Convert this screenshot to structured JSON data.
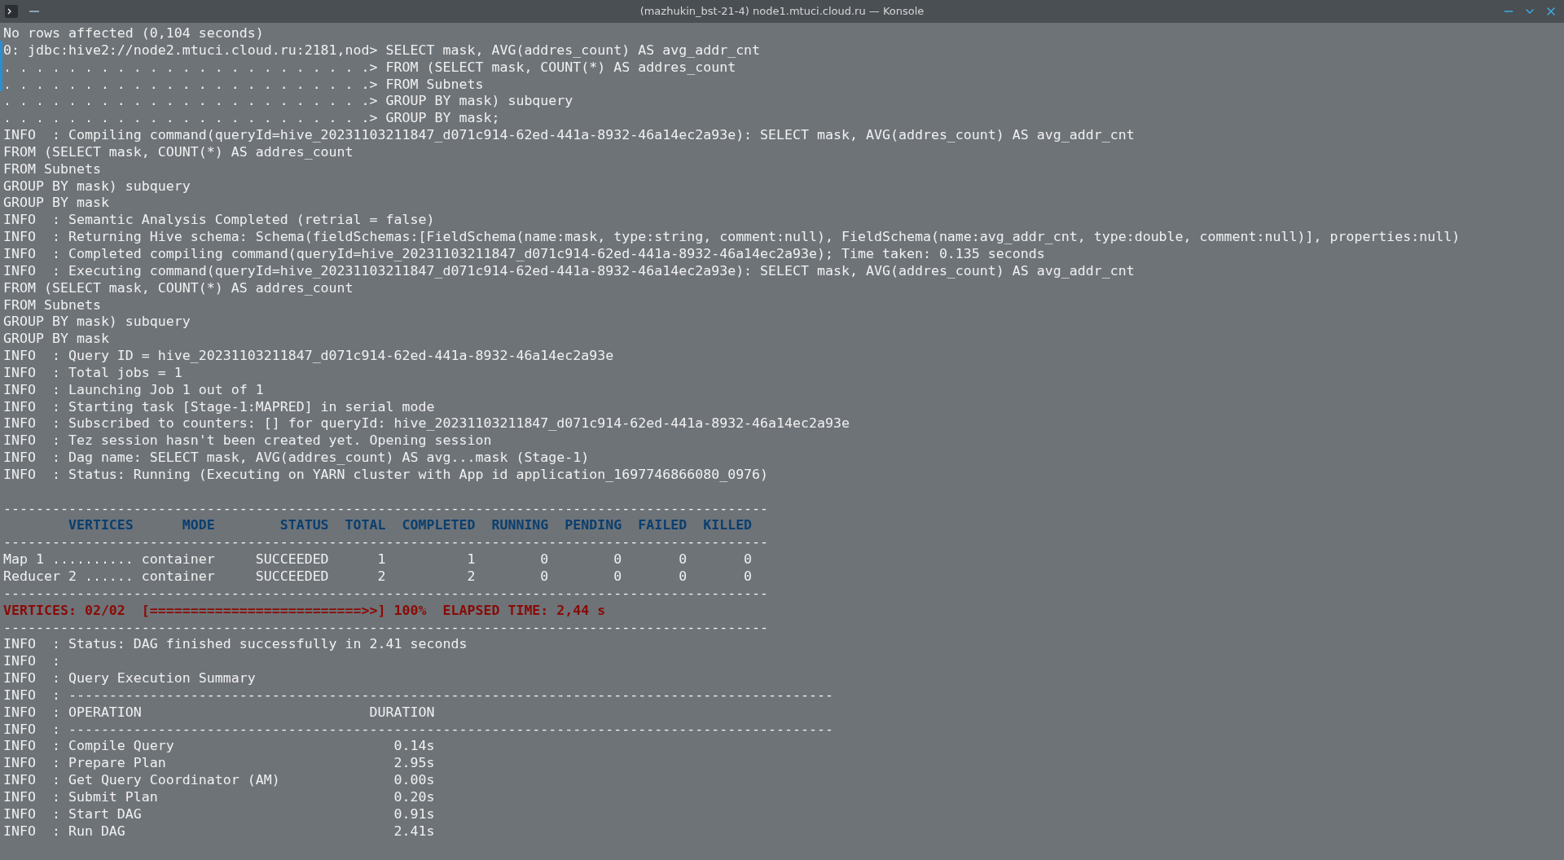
{
  "window": {
    "title": "(mazhukin_bst-21-4) node1.mtuci.cloud.ru — Konsole"
  },
  "terminal": {
    "lines": [
      {
        "kind": "output",
        "text": "No rows affected (0,104 seconds)"
      },
      {
        "kind": "output",
        "marked": true,
        "text": "0: jdbc:hive2://node2.mtuci.cloud.ru:2181,nod> SELECT mask, AVG(addres_count) AS avg_addr_cnt"
      },
      {
        "kind": "output",
        "marked": true,
        "text": ". . . . . . . . . . . . . . . . . . . . . . .> FROM (SELECT mask, COUNT(*) AS addres_count"
      },
      {
        "kind": "output",
        "marked": true,
        "text": ". . . . . . . . . . . . . . . . . . . . . . .> FROM Subnets"
      },
      {
        "kind": "output",
        "marked": false,
        "text": ". . . . . . . . . . . . . . . . . . . . . . .> GROUP BY mask) subquery"
      },
      {
        "kind": "output",
        "text": ". . . . . . . . . . . . . . . . . . . . . . .> GROUP BY mask;"
      },
      {
        "kind": "output",
        "text": "INFO  : Compiling command(queryId=hive_20231103211847_d071c914-62ed-441a-8932-46a14ec2a93e): SELECT mask, AVG(addres_count) AS avg_addr_cnt"
      },
      {
        "kind": "output",
        "text": "FROM (SELECT mask, COUNT(*) AS addres_count"
      },
      {
        "kind": "output",
        "text": "FROM Subnets"
      },
      {
        "kind": "output",
        "text": "GROUP BY mask) subquery"
      },
      {
        "kind": "output",
        "text": "GROUP BY mask"
      },
      {
        "kind": "output",
        "text": "INFO  : Semantic Analysis Completed (retrial = false)"
      },
      {
        "kind": "output",
        "text": "INFO  : Returning Hive schema: Schema(fieldSchemas:[FieldSchema(name:mask, type:string, comment:null), FieldSchema(name:avg_addr_cnt, type:double, comment:null)], properties:null)"
      },
      {
        "kind": "output",
        "text": "INFO  : Completed compiling command(queryId=hive_20231103211847_d071c914-62ed-441a-8932-46a14ec2a93e); Time taken: 0.135 seconds"
      },
      {
        "kind": "output",
        "text": "INFO  : Executing command(queryId=hive_20231103211847_d071c914-62ed-441a-8932-46a14ec2a93e): SELECT mask, AVG(addres_count) AS avg_addr_cnt"
      },
      {
        "kind": "output",
        "text": "FROM (SELECT mask, COUNT(*) AS addres_count"
      },
      {
        "kind": "output",
        "text": "FROM Subnets"
      },
      {
        "kind": "output",
        "text": "GROUP BY mask) subquery"
      },
      {
        "kind": "output",
        "text": "GROUP BY mask"
      },
      {
        "kind": "output",
        "text": "INFO  : Query ID = hive_20231103211847_d071c914-62ed-441a-8932-46a14ec2a93e"
      },
      {
        "kind": "output",
        "text": "INFO  : Total jobs = 1"
      },
      {
        "kind": "output",
        "text": "INFO  : Launching Job 1 out of 1"
      },
      {
        "kind": "output",
        "text": "INFO  : Starting task [Stage-1:MAPRED] in serial mode"
      },
      {
        "kind": "output",
        "text": "INFO  : Subscribed to counters: [] for queryId: hive_20231103211847_d071c914-62ed-441a-8932-46a14ec2a93e"
      },
      {
        "kind": "output",
        "text": "INFO  : Tez session hasn't been created yet. Opening session"
      },
      {
        "kind": "output",
        "text": "INFO  : Dag name: SELECT mask, AVG(addres_count) AS avg...mask (Stage-1)"
      },
      {
        "kind": "output",
        "text": "INFO  : Status: Running (Executing on YARN cluster with App id application_1697746866080_0976)"
      },
      {
        "kind": "blank"
      },
      {
        "kind": "output",
        "text": "----------------------------------------------------------------------------------------------"
      },
      {
        "kind": "header",
        "text": "        VERTICES      MODE        STATUS  TOTAL  COMPLETED  RUNNING  PENDING  FAILED  KILLED"
      },
      {
        "kind": "output",
        "text": "----------------------------------------------------------------------------------------------"
      },
      {
        "kind": "output",
        "text": "Map 1 .......... container     SUCCEEDED      1          1        0        0       0       0"
      },
      {
        "kind": "output",
        "text": "Reducer 2 ...... container     SUCCEEDED      2          2        0        0       0       0"
      },
      {
        "kind": "output",
        "text": "----------------------------------------------------------------------------------------------"
      },
      {
        "kind": "progress",
        "text": "VERTICES: 02/02  [==========================>>] 100%  ELAPSED TIME: 2,44 s"
      },
      {
        "kind": "output",
        "text": "----------------------------------------------------------------------------------------------"
      },
      {
        "kind": "output",
        "text": "INFO  : Status: DAG finished successfully in 2.41 seconds"
      },
      {
        "kind": "output",
        "text": "INFO  :"
      },
      {
        "kind": "output",
        "text": "INFO  : Query Execution Summary"
      },
      {
        "kind": "output",
        "text": "INFO  : ----------------------------------------------------------------------------------------------"
      },
      {
        "kind": "output",
        "text": "INFO  : OPERATION                            DURATION"
      },
      {
        "kind": "output",
        "text": "INFO  : ----------------------------------------------------------------------------------------------"
      },
      {
        "kind": "output",
        "text": "INFO  : Compile Query                           0.14s"
      },
      {
        "kind": "output",
        "text": "INFO  : Prepare Plan                            2.95s"
      },
      {
        "kind": "output",
        "text": "INFO  : Get Query Coordinator (AM)              0.00s"
      },
      {
        "kind": "output",
        "text": "INFO  : Submit Plan                             0.20s"
      },
      {
        "kind": "output",
        "text": "INFO  : Start DAG                               0.91s"
      },
      {
        "kind": "output",
        "text": "INFO  : Run DAG                                 2.41s"
      }
    ]
  }
}
